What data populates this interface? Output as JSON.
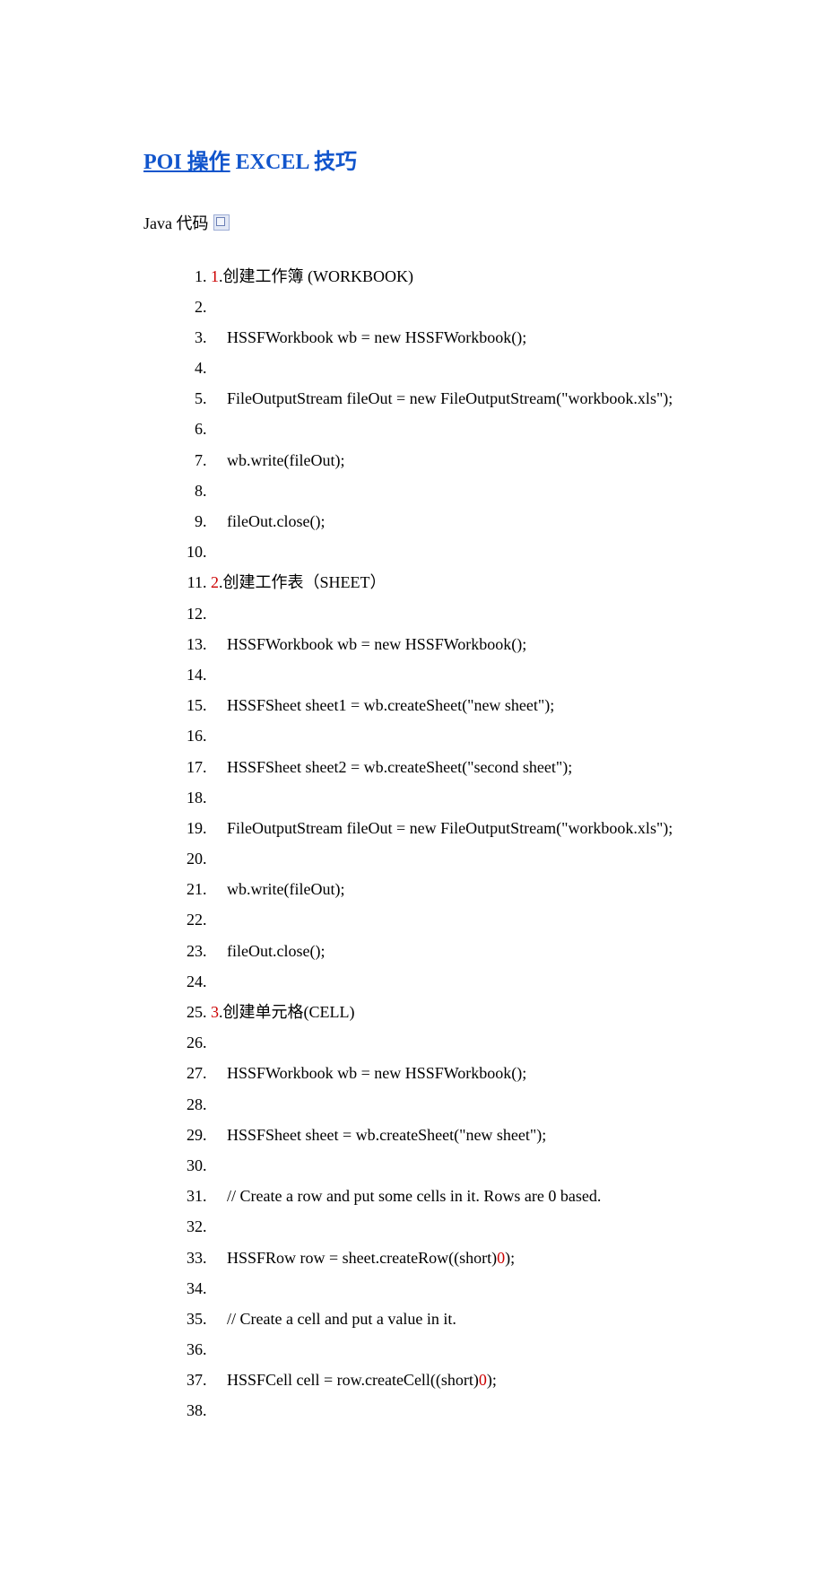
{
  "title": {
    "link_part": "POI 操作",
    "rest_part": " EXCEL 技巧"
  },
  "label": {
    "java_code": "Java 代码"
  },
  "code_lines": [
    {
      "pre": "",
      "red": "1",
      "post": ".创建工作簿 (WORKBOOK)   "
    },
    {
      "pre": "  ",
      "red": "",
      "post": ""
    },
    {
      "pre": "    HSSFWorkbook wb = new HSSFWorkbook();   ",
      "red": "",
      "post": ""
    },
    {
      "pre": "  ",
      "red": "",
      "post": ""
    },
    {
      "pre": "    FileOutputStream fileOut = new FileOutputStream(\"workbook.xls\");   ",
      "red": "",
      "post": ""
    },
    {
      "pre": "  ",
      "red": "",
      "post": ""
    },
    {
      "pre": "    wb.write(fileOut);   ",
      "red": "",
      "post": ""
    },
    {
      "pre": "  ",
      "red": "",
      "post": ""
    },
    {
      "pre": "    fileOut.close();   ",
      "red": "",
      "post": ""
    },
    {
      "pre": "  ",
      "red": "",
      "post": ""
    },
    {
      "pre": "",
      "red": "2",
      "post": ".创建工作表（SHEET）   "
    },
    {
      "pre": "  ",
      "red": "",
      "post": ""
    },
    {
      "pre": "    HSSFWorkbook wb = new HSSFWorkbook();   ",
      "red": "",
      "post": ""
    },
    {
      "pre": "  ",
      "red": "",
      "post": ""
    },
    {
      "pre": "    HSSFSheet sheet1 = wb.createSheet(\"new sheet\");   ",
      "red": "",
      "post": ""
    },
    {
      "pre": "  ",
      "red": "",
      "post": ""
    },
    {
      "pre": "    HSSFSheet sheet2 = wb.createSheet(\"second sheet\");   ",
      "red": "",
      "post": ""
    },
    {
      "pre": "  ",
      "red": "",
      "post": ""
    },
    {
      "pre": "    FileOutputStream fileOut = new FileOutputStream(\"workbook.xls\");   ",
      "red": "",
      "post": ""
    },
    {
      "pre": "  ",
      "red": "",
      "post": ""
    },
    {
      "pre": "    wb.write(fileOut);   ",
      "red": "",
      "post": ""
    },
    {
      "pre": "  ",
      "red": "",
      "post": ""
    },
    {
      "pre": "    fileOut.close();   ",
      "red": "",
      "post": ""
    },
    {
      "pre": "  ",
      "red": "",
      "post": ""
    },
    {
      "pre": "",
      "red": "3",
      "post": ".创建单元格(CELL)   "
    },
    {
      "pre": "  ",
      "red": "",
      "post": ""
    },
    {
      "pre": "    HSSFWorkbook wb = new HSSFWorkbook();   ",
      "red": "",
      "post": ""
    },
    {
      "pre": "  ",
      "red": "",
      "post": ""
    },
    {
      "pre": "    HSSFSheet sheet = wb.createSheet(\"new sheet\");   ",
      "red": "",
      "post": ""
    },
    {
      "pre": "  ",
      "red": "",
      "post": ""
    },
    {
      "pre": "    // Create a row and put some cells in it. Rows are 0 based.   ",
      "red": "",
      "post": ""
    },
    {
      "pre": "  ",
      "red": "",
      "post": ""
    },
    {
      "pre": "    HSSFRow row = sheet.createRow((short)",
      "red": "0",
      "post": ");   "
    },
    {
      "pre": "  ",
      "red": "",
      "post": ""
    },
    {
      "pre": "    // Create a cell and put a value in it.   ",
      "red": "",
      "post": ""
    },
    {
      "pre": "  ",
      "red": "",
      "post": ""
    },
    {
      "pre": "    HSSFCell cell = row.createCell((short)",
      "red": "0",
      "post": ");   "
    },
    {
      "pre": "  ",
      "red": "",
      "post": ""
    }
  ]
}
